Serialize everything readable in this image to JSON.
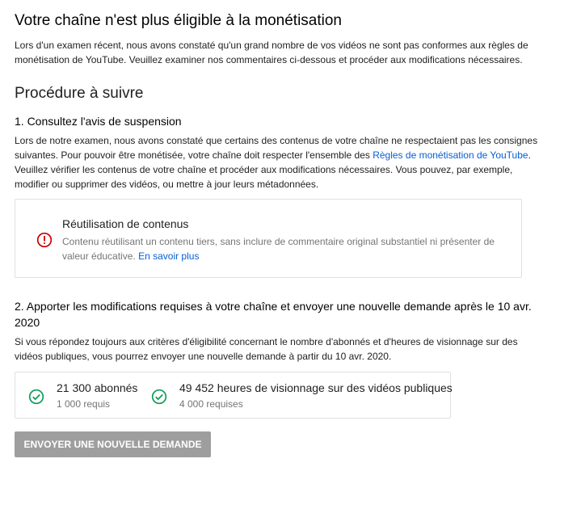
{
  "header": {
    "title": "Votre chaîne n'est plus éligible à la monétisation",
    "intro_line1": "Lors d'un examen récent, nous avons constaté qu'un grand nombre de vos vidéos ne sont pas conformes aux règles de",
    "intro_line2": "monétisation de YouTube. Veuillez examiner nos commentaires ci-dessous et procéder aux modifications nécessaires."
  },
  "procedure": {
    "heading": "Procédure à suivre",
    "step1": {
      "title": "1. Consultez l'avis de suspension",
      "line1": "Lors de notre examen, nous avons constaté que certains des contenus de votre chaîne ne respectaient pas les consignes",
      "line2_before": "suivantes. Pour pouvoir être monétisée, votre chaîne doit respecter l'ensemble des ",
      "line2_link": "Règles de monétisation de YouTube",
      "line2_after": ".",
      "line3": "Veuillez vérifier les contenus de votre chaîne et procéder aux modifications nécessaires. Vous pouvez, par exemple,",
      "line4": "modifier ou supprimer des vidéos, ou mettre à jour leurs métadonnées.",
      "issue": {
        "icon": "alert-circle-icon",
        "title": "Réutilisation de contenus",
        "desc_line1": "Contenu réutilisant un contenu tiers, sans inclure de commentaire original substantiel ni présenter de",
        "desc_line2": "valeur éducative.",
        "link": "En savoir plus"
      }
    },
    "step2": {
      "title_line1": "2. Apporter les modifications requises à votre chaîne et envoyer une nouvelle demande après le 10 avr.",
      "title_line2": "2020",
      "line1": "Si vous répondez toujours aux critères d'éligibilité concernant le nombre d'abonnés et d'heures de visionnage sur des",
      "line2": "vidéos publiques, vous pourrez envoyer une nouvelle demande à partir du 10 avr. 2020.",
      "stats": [
        {
          "icon": "check-circle-icon",
          "main": "21 300 abonnés",
          "sub": "1 000 requis"
        },
        {
          "icon": "check-circle-icon",
          "main": "49 452 heures de visionnage sur des vidéos publiques",
          "sub": "4 000 requises"
        }
      ]
    }
  },
  "button": {
    "label": "ENVOYER UNE NOUVELLE DEMANDE"
  },
  "colors": {
    "link": "#065fd4",
    "alert": "#cc0000",
    "check": "#0f9d58",
    "button_disabled": "#9e9e9e"
  }
}
